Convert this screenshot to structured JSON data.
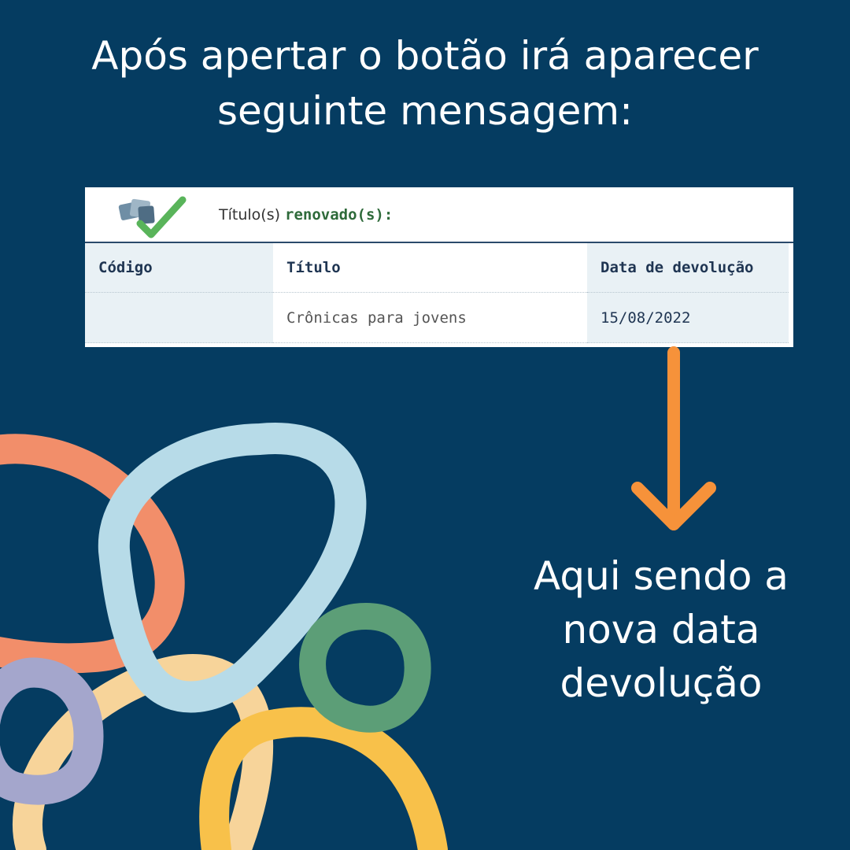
{
  "headline": {
    "line1": "Após apertar o botão irá aparecer",
    "line2": "seguinte mensagem:"
  },
  "panel": {
    "message_prefix": "Título(s) ",
    "message_strong": "renovado(s):",
    "icon": "books-checkmark-icon",
    "table": {
      "columns": [
        "Código",
        "Título",
        "Data de devolução"
      ],
      "rows": [
        {
          "codigo": "",
          "titulo": "Crônicas para jovens",
          "data": "15/08/2022"
        }
      ]
    }
  },
  "caption": {
    "line1": "Aqui sendo a",
    "line2": "nova data",
    "line3": "devolução"
  },
  "colors": {
    "background": "#053c61",
    "arrow": "#f6923a",
    "blob_orange": "#f28e6a",
    "blob_lightblue": "#b7dbe8",
    "blob_green": "#5c9e77",
    "blob_purple": "#a4a6cc",
    "blob_peach": "#f7d49a",
    "blob_yellow": "#f8c14a"
  }
}
